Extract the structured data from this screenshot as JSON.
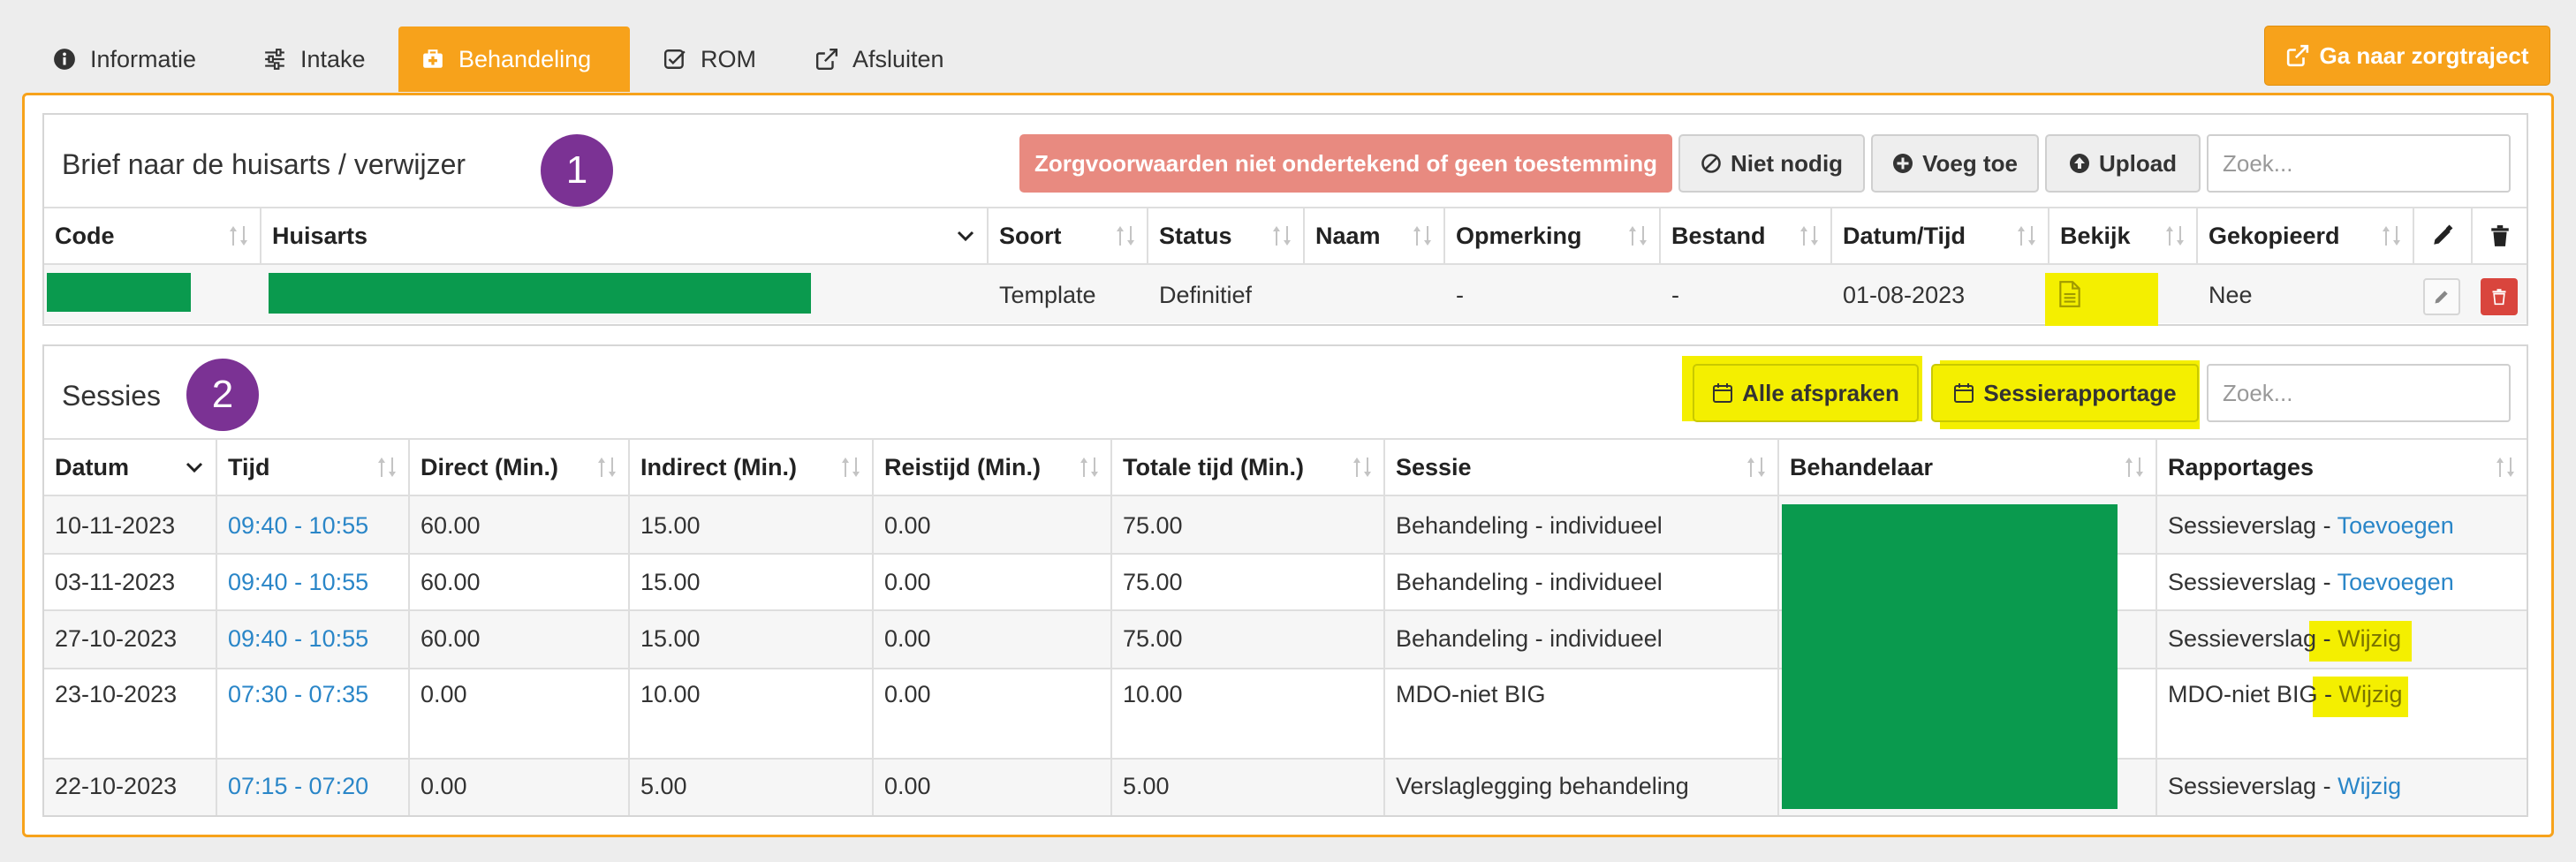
{
  "tabs": [
    {
      "label": "Informatie",
      "icon": "info-circle-icon"
    },
    {
      "label": "Intake",
      "icon": "sliders-icon"
    },
    {
      "label": "Behandeling",
      "icon": "medkit-icon"
    },
    {
      "label": "ROM",
      "icon": "check-square-icon"
    },
    {
      "label": "Afsluiten",
      "icon": "external-link-icon"
    }
  ],
  "active_tab": "Behandeling",
  "header_button": {
    "label": "Ga naar zorgtraject",
    "icon": "external-link-icon"
  },
  "colors": {
    "accent": "#f7a21b",
    "danger": "#e88a80",
    "link": "#2a86c8",
    "highlight": "#f4ef00",
    "badge": "#7b3294",
    "redacted": "#0a9a4e"
  },
  "brief": {
    "title": "Brief naar de huisarts / verwijzer",
    "badge": "1",
    "warning_button": "Zorgvoorwaarden niet ondertekend of geen toestemming",
    "niet_nodig": "Niet nodig",
    "voeg_toe": "Voeg toe",
    "upload": "Upload",
    "search_placeholder": "Zoek...",
    "columns": [
      "Code",
      "Huisarts",
      "Soort",
      "Status",
      "Naam",
      "Opmerking",
      "Bestand",
      "Datum/Tijd",
      "Bekijk",
      "Gekopieerd"
    ],
    "row": {
      "code": "",
      "huisarts": "",
      "soort": "Template",
      "status": "Definitief",
      "naam": "",
      "opmerking": "-",
      "bestand": "-",
      "datum": "01-08-2023",
      "gekopieerd": "Nee"
    }
  },
  "sessies": {
    "title": "Sessies",
    "badge": "2",
    "alle_afspraken": "Alle afspraken",
    "sessierapportage": "Sessierapportage",
    "search_placeholder": "Zoek...",
    "columns": [
      "Datum",
      "Tijd",
      "Direct (Min.)",
      "Indirect (Min.)",
      "Reistijd (Min.)",
      "Totale tijd (Min.)",
      "Sessie",
      "Behandelaar",
      "Rapportages"
    ],
    "rows": [
      {
        "datum": "10-11-2023",
        "tijd": "09:40 - 10:55",
        "direct": "60.00",
        "indirect": "15.00",
        "reistijd": "0.00",
        "totaal": "75.00",
        "sessie": "Behandeling - individueel",
        "rap_prefix": "Sessieverslag -",
        "rap_link": "Toevoegen"
      },
      {
        "datum": "03-11-2023",
        "tijd": "09:40 - 10:55",
        "direct": "60.00",
        "indirect": "15.00",
        "reistijd": "0.00",
        "totaal": "75.00",
        "sessie": "Behandeling - individueel",
        "rap_prefix": "Sessieverslag -",
        "rap_link": "Toevoegen"
      },
      {
        "datum": "27-10-2023",
        "tijd": "09:40 - 10:55",
        "direct": "60.00",
        "indirect": "15.00",
        "reistijd": "0.00",
        "totaal": "75.00",
        "sessie": "Behandeling - individueel",
        "rap_prefix": "Sessieverslag -",
        "rap_link": "Wijzig"
      },
      {
        "datum": "23-10-2023",
        "tijd": "07:30 - 07:35",
        "direct": "0.00",
        "indirect": "10.00",
        "reistijd": "0.00",
        "totaal": "10.00",
        "sessie": "MDO-niet BIG",
        "rap_prefix": "MDO-niet BIG -",
        "rap_link": "Wijzig"
      },
      {
        "datum": "22-10-2023",
        "tijd": "07:15 - 07:20",
        "direct": "0.00",
        "indirect": "5.00",
        "reistijd": "0.00",
        "totaal": "5.00",
        "sessie": "Verslaglegging behandeling",
        "rap_prefix": "Sessieverslag -",
        "rap_link": "Wijzig"
      }
    ]
  }
}
